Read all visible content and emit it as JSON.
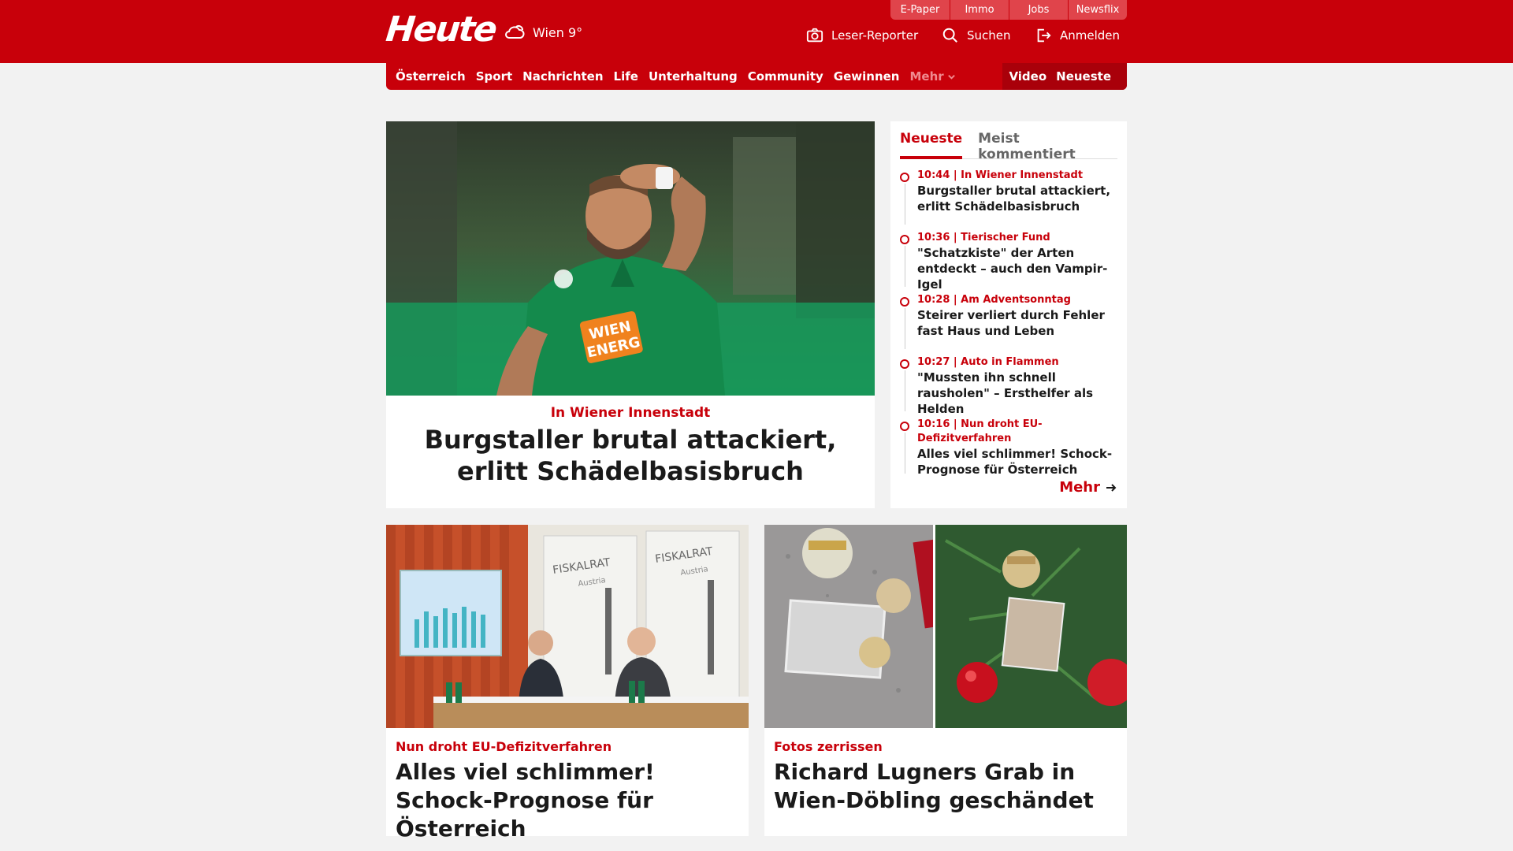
{
  "header": {
    "logo": "Heute",
    "weather": {
      "icon": "weather-cloud-icon",
      "text": "Wien 9°"
    },
    "top_links": [
      "E-Paper",
      "Immo",
      "Jobs",
      "Newsflix"
    ],
    "actions": {
      "reporter": "Leser-Reporter",
      "search": "Suchen",
      "login": "Anmelden"
    }
  },
  "nav": {
    "items": [
      "Österreich",
      "Sport",
      "Nachrichten",
      "Life",
      "Unterhaltung",
      "Community",
      "Gewinnen"
    ],
    "more": "Mehr",
    "right": [
      "Video",
      "Neueste"
    ]
  },
  "hero": {
    "kicker": "In Wiener Innenstadt",
    "title": "Burgstaller brutal attackiert, erlitt Schädelbasisbruch",
    "jersey_text": [
      "WIEN",
      "ENERG"
    ]
  },
  "sidebar": {
    "tabs": [
      "Neueste",
      "Meist kommentiert"
    ],
    "items": [
      {
        "meta": "10:44 | In Wiener Innenstadt",
        "title": "Burgstaller brutal attackiert, erlitt Schädelbasisbruch"
      },
      {
        "meta": "10:36 | Tierischer Fund",
        "title": "\"Schatzkiste\" der Arten entdeckt – auch den Vampir-Igel"
      },
      {
        "meta": "10:28 | Am Adventsonntag",
        "title": "Steirer verliert durch Fehler fast Haus und Leben"
      },
      {
        "meta": "10:27 | Auto in Flammen",
        "title": "\"Mussten ihn schnell rausholen\" – Ersthelfer als Helden"
      },
      {
        "meta": "10:16 | Nun droht EU-Defizitverfahren",
        "title": "Alles viel schlimmer! Schock-Prognose für Österreich"
      }
    ],
    "more": "Mehr"
  },
  "cards": [
    {
      "kicker": "Nun droht EU-Defizitverfahren",
      "title": "Alles viel schlimmer! Schock-Prognose für Österreich",
      "sign_text": "FISKALRAT",
      "sign_sub": "Austria"
    },
    {
      "kicker": "Fotos zerrissen",
      "title": "Richard Lugners Grab in Wien-Döbling geschändet"
    }
  ],
  "colors": {
    "brand": "#c8000a",
    "brand_dark": "#a9000a",
    "link_light": "#e0444b"
  }
}
